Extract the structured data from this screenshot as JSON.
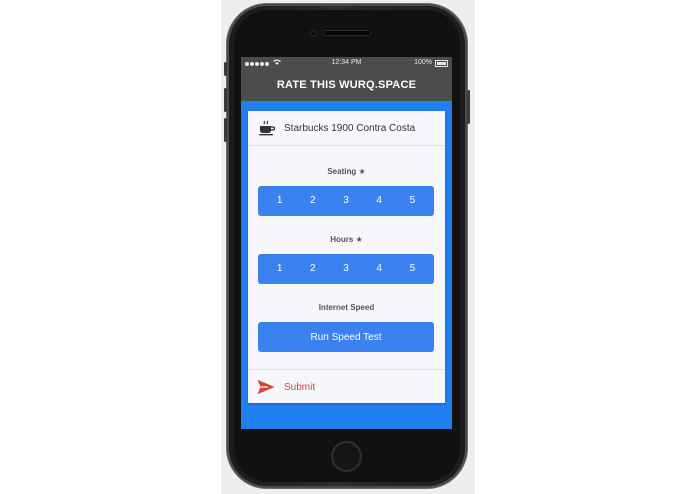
{
  "statusbar": {
    "signal_dots": 5,
    "time": "12:34 PM",
    "battery": "100%"
  },
  "appbar": {
    "title": "RATE THIS WURQ.SPACE"
  },
  "place": {
    "icon": "coffee-cup-icon",
    "name": "Starbucks 1900 Contra Costa"
  },
  "seating": {
    "label": "Seating ★",
    "options": [
      "1",
      "2",
      "3",
      "4",
      "5"
    ]
  },
  "hours": {
    "label": "Hours ★",
    "options": [
      "1",
      "2",
      "3",
      "4",
      "5"
    ]
  },
  "internet": {
    "label": "Internet Speed",
    "button": "Run Speed Test"
  },
  "submit": {
    "icon": "send-icon",
    "label": "Submit"
  },
  "colors": {
    "primary": "#3b82f0",
    "screen_bg": "#1f7ef0",
    "appbar": "#4b4c4e",
    "submit": "#d9423c"
  }
}
